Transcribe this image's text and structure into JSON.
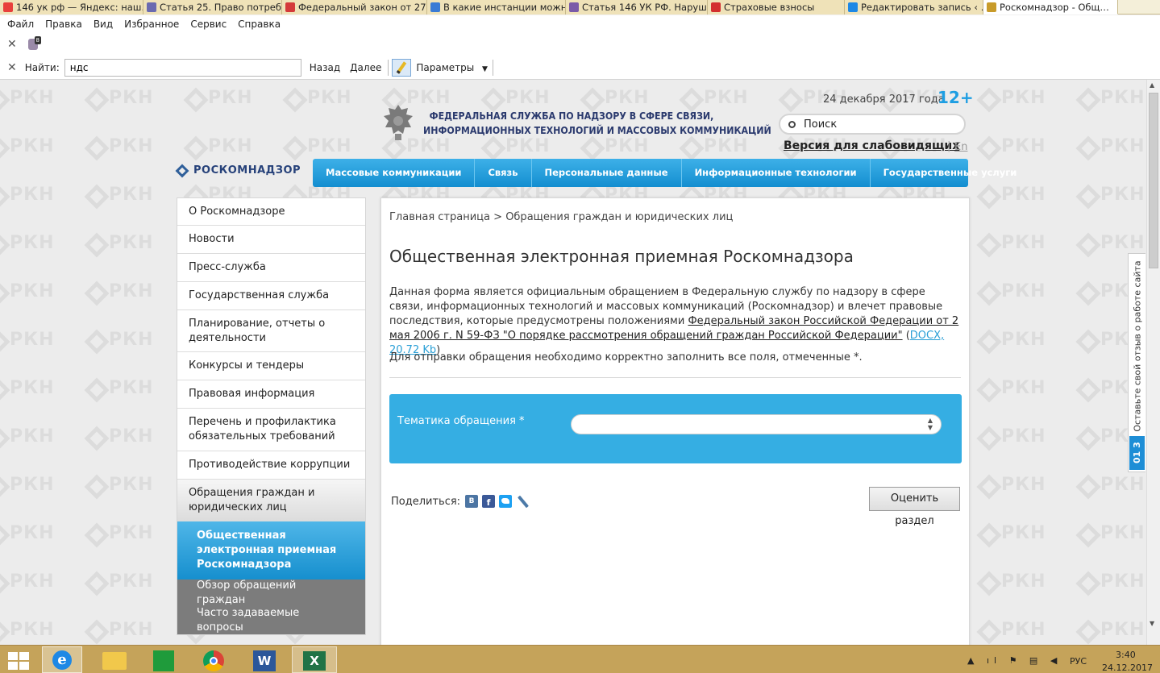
{
  "browser": {
    "tabs": [
      {
        "label": "146 ук рф — Яндекс: наш…",
        "icon": "yandex-icon",
        "color": "#e8403c"
      },
      {
        "label": "Статья 25. Право потреб…",
        "icon": "consultant-icon",
        "color": "#6a6ab0"
      },
      {
        "label": "Федеральный закон от 27…",
        "icon": "flag-icon",
        "color": "#d43a3a"
      },
      {
        "label": "В какие инстанции можн…",
        "icon": "page-icon",
        "color": "#3a7bd5"
      },
      {
        "label": "Статья 146 УК РФ. Наруш…",
        "icon": "zakon-icon",
        "color": "#7a5aa8"
      },
      {
        "label": "Страховые взносы",
        "icon": "nn-icon",
        "color": "#d32f2f"
      },
      {
        "label": "Редактировать запись ‹ …",
        "icon": "ie-icon",
        "color": "#1e88e5"
      },
      {
        "label": "Роскомнадзор - Общ…",
        "icon": "emblem-icon",
        "color": "#c89b2a"
      }
    ],
    "menu": [
      "Файл",
      "Правка",
      "Вид",
      "Избранное",
      "Сервис",
      "Справка"
    ],
    "find": {
      "label": "Найти:",
      "value": "ндс",
      "back": "Назад",
      "next": "Далее",
      "params": "Параметры"
    }
  },
  "site": {
    "date": "24 декабря 2017 года",
    "age": "12+",
    "title_line1": "ФЕДЕРАЛЬНАЯ СЛУЖБА ПО НАДЗОРУ В СФЕРЕ СВЯЗИ,",
    "title_line2": "ИНФОРМАЦИОННЫХ ТЕХНОЛОГИЙ И МАССОВЫХ КОММУНИКАЦИЙ",
    "search_placeholder": "Поиск",
    "accessible": "Версия для слабовидящих",
    "separator": "|",
    "lang": "En",
    "logo": "РОСКОМНАДЗОР",
    "watermark": "РКН",
    "nav": [
      "Массовые коммуникации",
      "Связь",
      "Персональные данные",
      "Информационные технологии",
      "Государственные услуги"
    ]
  },
  "sidebar": {
    "items": [
      {
        "label": "О Роскомнадзоре"
      },
      {
        "label": "Новости"
      },
      {
        "label": "Пресс-служба"
      },
      {
        "label": "Государственная служба"
      },
      {
        "label": "Планирование, отчеты о деятельности"
      },
      {
        "label": "Конкурсы и тендеры"
      },
      {
        "label": "Правовая информация"
      },
      {
        "label": "Перечень и профилактика обязательных требований"
      },
      {
        "label": "Противодействие коррупции"
      },
      {
        "label": "Обращения граждан и юридических лиц"
      }
    ],
    "subitems": [
      {
        "label": "Общественная электронная приемная Роскомнадзора"
      },
      {
        "label": "Обзор обращений граждан"
      },
      {
        "label": "Часто задаваемые вопросы"
      }
    ]
  },
  "content": {
    "breadcrumb_home": "Главная страница",
    "breadcrumb_sep": ">",
    "breadcrumb_current": "Обращения граждан и юридических лиц",
    "heading": "Общественная электронная приемная Роскомнадзора",
    "para1": "Данная форма является официальным обращением в Федеральную службу по надзору в сфере связи, информационных технологий и массовых коммуникаций (Роскомнадзор) и влечет правовые последствия, которые предусмотрены положениями",
    "law_link": "Федеральный закон Российской Федерации от 2 мая 2006 г. N 59-ФЗ \"О порядке рассмотрения обращений граждан Российской Федерации\"",
    "doc_open": "(",
    "doc_link": "DOCX, 20.72 Kb",
    "doc_close": ")",
    "para2": "Для отправки обращения необходимо корректно заполнить все поля, отмеченные *.",
    "topic_label": "Тематика обращения *",
    "topic_value": "",
    "share_label": "Поделиться:",
    "rate_button": "Оценить раздел"
  },
  "feedback_tab": {
    "label": "Оставьте свой отзыв о работе сайта",
    "badge": "01 3"
  },
  "taskbar": {
    "lang": "РУС",
    "time": "3:40",
    "date": "24.12.2017"
  }
}
